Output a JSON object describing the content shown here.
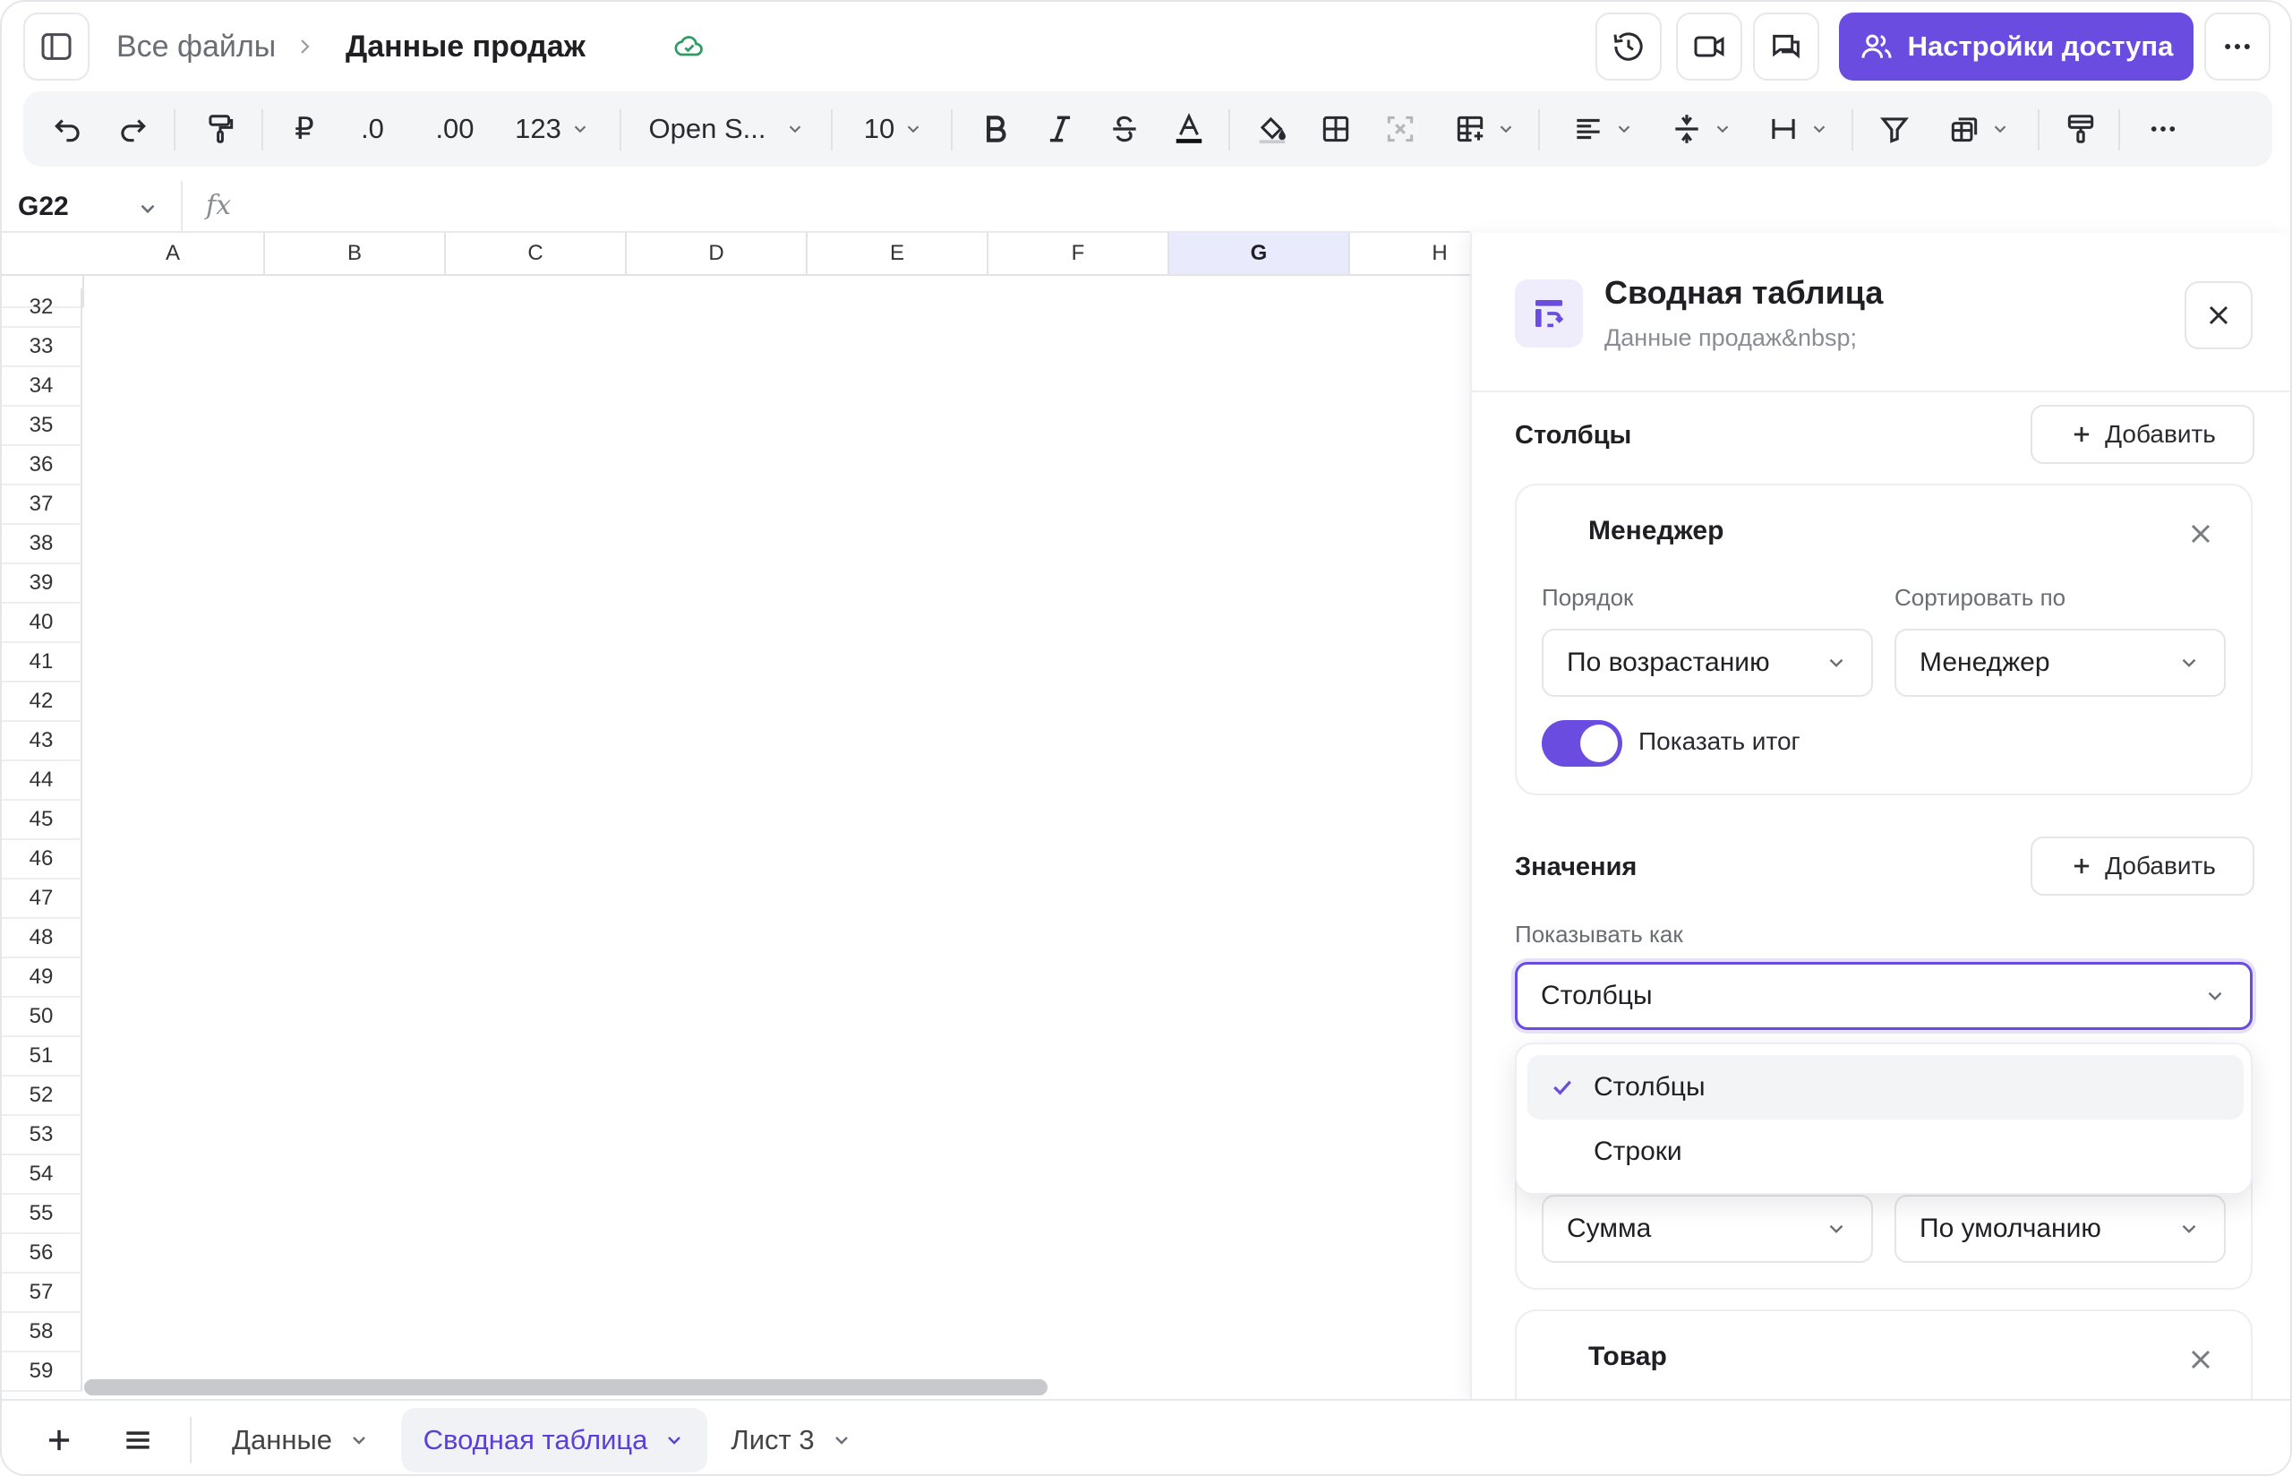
{
  "header": {
    "breadcrumb_root": "Все файлы",
    "file_name": "Данные продаж",
    "share_button": "Настройки доступа"
  },
  "toolbar": {
    "currency": "₽",
    "decimal_less": ".0",
    "decimal_more": ".00",
    "number_format": "123",
    "font_name": "Open S...",
    "font_size": "10"
  },
  "formula_bar": {
    "cell_ref": "G22",
    "fx": "fx"
  },
  "grid": {
    "columns": [
      "A",
      "B",
      "C",
      "D",
      "E",
      "F",
      "G",
      "H"
    ],
    "selected_column": "G",
    "rows": [
      "32",
      "33",
      "34",
      "35",
      "36",
      "37",
      "38",
      "39",
      "40",
      "41",
      "42",
      "43",
      "44",
      "45",
      "46",
      "47",
      "48",
      "49",
      "50",
      "51",
      "52",
      "53",
      "54",
      "55",
      "56",
      "57",
      "58",
      "59"
    ]
  },
  "panel": {
    "title": "Сводная таблица",
    "subtitle": "Данные продаж&nbsp;",
    "columns_section": {
      "title": "Столбцы",
      "add_label": "Добавить",
      "field_name": "Менеджер",
      "order_label": "Порядок",
      "order_value": "По возрастанию",
      "sort_label": "Сортировать по",
      "sort_value": "Менеджер",
      "show_total_label": "Показать итог"
    },
    "values_section": {
      "title": "Значения",
      "add_label": "Добавить",
      "show_as_label": "Показывать как",
      "show_as_value": "Столбцы",
      "options": [
        "Столбцы",
        "Строки"
      ],
      "selected_option": "Столбцы",
      "aggregate_value": "Сумма",
      "sort_value": "По умолчанию"
    },
    "next_field_name": "Товар"
  },
  "sheet_tabs": {
    "tabs": [
      "Данные",
      "Сводная таблица",
      "Лист 3"
    ],
    "active": "Сводная таблица"
  },
  "colors": {
    "accent": "#6a4de0",
    "selected_column_bg": "#e9eafc",
    "cloud_ok": "#2e9b63"
  }
}
